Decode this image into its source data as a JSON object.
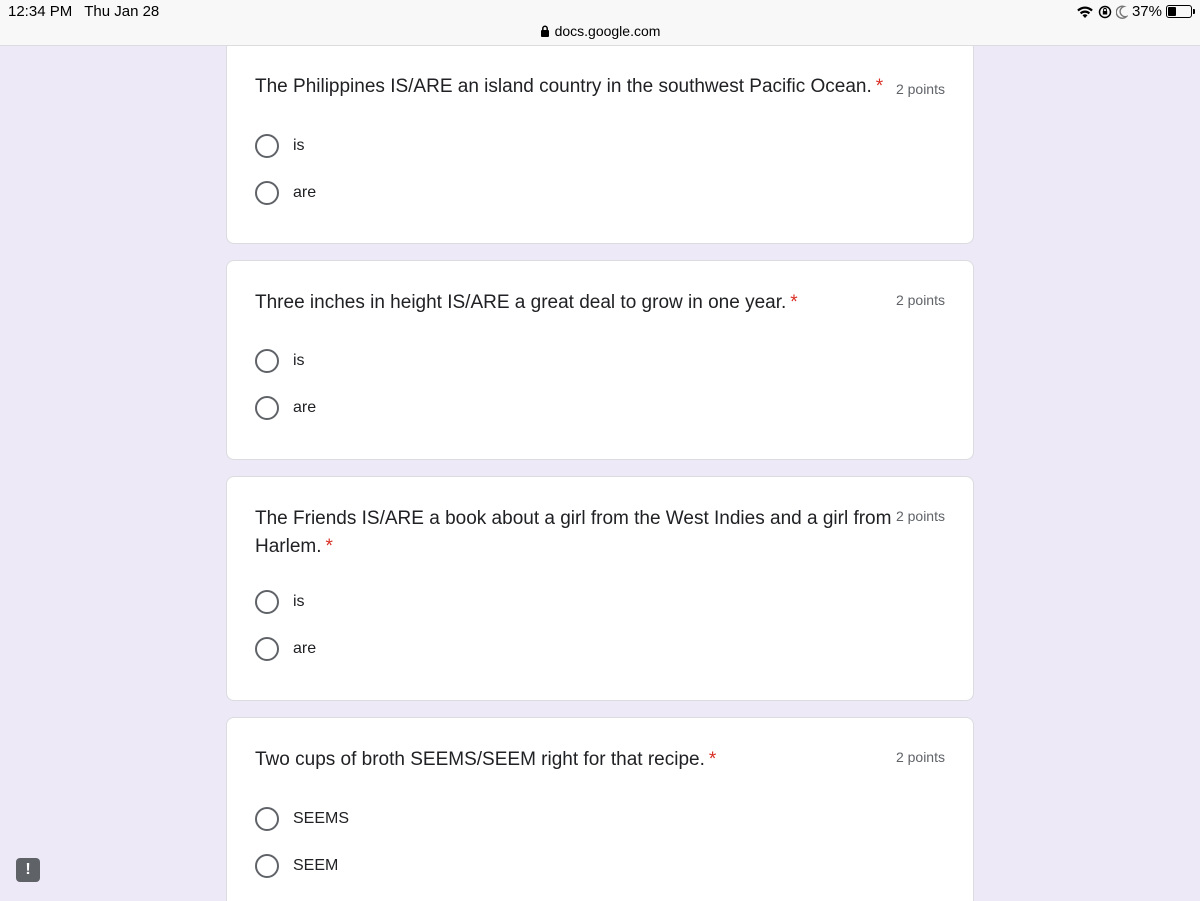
{
  "status": {
    "time": "12:34 PM",
    "date": "Thu Jan 28",
    "battery": "37%"
  },
  "browser": {
    "url": "docs.google.com"
  },
  "questions": [
    {
      "title": "The Philippines IS/ARE an island country in the southwest Pacific Ocean.",
      "required": "*",
      "points": "2 points",
      "options": [
        "is",
        "are"
      ]
    },
    {
      "title": "Three inches in height IS/ARE a great deal to grow in one year.",
      "required": "*",
      "points": "2 points",
      "options": [
        "is",
        "are"
      ]
    },
    {
      "title": "The Friends IS/ARE a book about a girl from the West Indies and a girl from Harlem.",
      "required": "*",
      "points": "2 points",
      "options": [
        "is",
        "are"
      ]
    },
    {
      "title": "Two cups of broth SEEMS/SEEM right for that recipe.",
      "required": "*",
      "points": "2 points",
      "options": [
        "SEEMS",
        "SEEM"
      ]
    }
  ],
  "feedback": {
    "icon": "report-problem-icon",
    "glyph": "!"
  }
}
